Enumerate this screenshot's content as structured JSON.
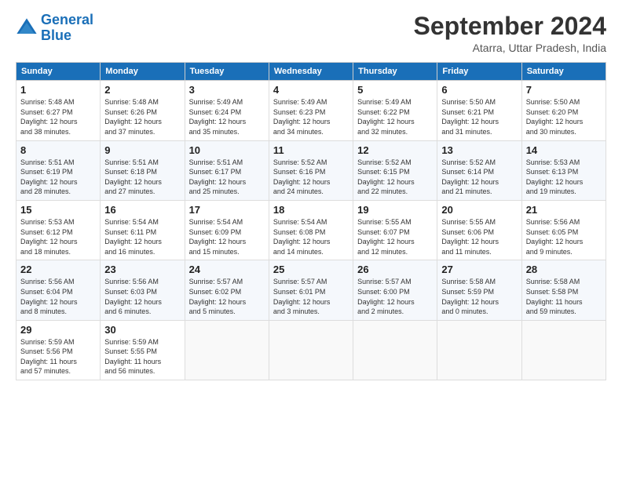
{
  "logo": {
    "text_general": "General",
    "text_blue": "Blue"
  },
  "header": {
    "month": "September 2024",
    "location": "Atarra, Uttar Pradesh, India"
  },
  "weekdays": [
    "Sunday",
    "Monday",
    "Tuesday",
    "Wednesday",
    "Thursday",
    "Friday",
    "Saturday"
  ],
  "weeks": [
    [
      {
        "day": "1",
        "info": "Sunrise: 5:48 AM\nSunset: 6:27 PM\nDaylight: 12 hours\nand 38 minutes."
      },
      {
        "day": "2",
        "info": "Sunrise: 5:48 AM\nSunset: 6:26 PM\nDaylight: 12 hours\nand 37 minutes."
      },
      {
        "day": "3",
        "info": "Sunrise: 5:49 AM\nSunset: 6:24 PM\nDaylight: 12 hours\nand 35 minutes."
      },
      {
        "day": "4",
        "info": "Sunrise: 5:49 AM\nSunset: 6:23 PM\nDaylight: 12 hours\nand 34 minutes."
      },
      {
        "day": "5",
        "info": "Sunrise: 5:49 AM\nSunset: 6:22 PM\nDaylight: 12 hours\nand 32 minutes."
      },
      {
        "day": "6",
        "info": "Sunrise: 5:50 AM\nSunset: 6:21 PM\nDaylight: 12 hours\nand 31 minutes."
      },
      {
        "day": "7",
        "info": "Sunrise: 5:50 AM\nSunset: 6:20 PM\nDaylight: 12 hours\nand 30 minutes."
      }
    ],
    [
      {
        "day": "8",
        "info": "Sunrise: 5:51 AM\nSunset: 6:19 PM\nDaylight: 12 hours\nand 28 minutes."
      },
      {
        "day": "9",
        "info": "Sunrise: 5:51 AM\nSunset: 6:18 PM\nDaylight: 12 hours\nand 27 minutes."
      },
      {
        "day": "10",
        "info": "Sunrise: 5:51 AM\nSunset: 6:17 PM\nDaylight: 12 hours\nand 25 minutes."
      },
      {
        "day": "11",
        "info": "Sunrise: 5:52 AM\nSunset: 6:16 PM\nDaylight: 12 hours\nand 24 minutes."
      },
      {
        "day": "12",
        "info": "Sunrise: 5:52 AM\nSunset: 6:15 PM\nDaylight: 12 hours\nand 22 minutes."
      },
      {
        "day": "13",
        "info": "Sunrise: 5:52 AM\nSunset: 6:14 PM\nDaylight: 12 hours\nand 21 minutes."
      },
      {
        "day": "14",
        "info": "Sunrise: 5:53 AM\nSunset: 6:13 PM\nDaylight: 12 hours\nand 19 minutes."
      }
    ],
    [
      {
        "day": "15",
        "info": "Sunrise: 5:53 AM\nSunset: 6:12 PM\nDaylight: 12 hours\nand 18 minutes."
      },
      {
        "day": "16",
        "info": "Sunrise: 5:54 AM\nSunset: 6:11 PM\nDaylight: 12 hours\nand 16 minutes."
      },
      {
        "day": "17",
        "info": "Sunrise: 5:54 AM\nSunset: 6:09 PM\nDaylight: 12 hours\nand 15 minutes."
      },
      {
        "day": "18",
        "info": "Sunrise: 5:54 AM\nSunset: 6:08 PM\nDaylight: 12 hours\nand 14 minutes."
      },
      {
        "day": "19",
        "info": "Sunrise: 5:55 AM\nSunset: 6:07 PM\nDaylight: 12 hours\nand 12 minutes."
      },
      {
        "day": "20",
        "info": "Sunrise: 5:55 AM\nSunset: 6:06 PM\nDaylight: 12 hours\nand 11 minutes."
      },
      {
        "day": "21",
        "info": "Sunrise: 5:56 AM\nSunset: 6:05 PM\nDaylight: 12 hours\nand 9 minutes."
      }
    ],
    [
      {
        "day": "22",
        "info": "Sunrise: 5:56 AM\nSunset: 6:04 PM\nDaylight: 12 hours\nand 8 minutes."
      },
      {
        "day": "23",
        "info": "Sunrise: 5:56 AM\nSunset: 6:03 PM\nDaylight: 12 hours\nand 6 minutes."
      },
      {
        "day": "24",
        "info": "Sunrise: 5:57 AM\nSunset: 6:02 PM\nDaylight: 12 hours\nand 5 minutes."
      },
      {
        "day": "25",
        "info": "Sunrise: 5:57 AM\nSunset: 6:01 PM\nDaylight: 12 hours\nand 3 minutes."
      },
      {
        "day": "26",
        "info": "Sunrise: 5:57 AM\nSunset: 6:00 PM\nDaylight: 12 hours\nand 2 minutes."
      },
      {
        "day": "27",
        "info": "Sunrise: 5:58 AM\nSunset: 5:59 PM\nDaylight: 12 hours\nand 0 minutes."
      },
      {
        "day": "28",
        "info": "Sunrise: 5:58 AM\nSunset: 5:58 PM\nDaylight: 11 hours\nand 59 minutes."
      }
    ],
    [
      {
        "day": "29",
        "info": "Sunrise: 5:59 AM\nSunset: 5:56 PM\nDaylight: 11 hours\nand 57 minutes."
      },
      {
        "day": "30",
        "info": "Sunrise: 5:59 AM\nSunset: 5:55 PM\nDaylight: 11 hours\nand 56 minutes."
      },
      {
        "day": "",
        "info": ""
      },
      {
        "day": "",
        "info": ""
      },
      {
        "day": "",
        "info": ""
      },
      {
        "day": "",
        "info": ""
      },
      {
        "day": "",
        "info": ""
      }
    ]
  ]
}
